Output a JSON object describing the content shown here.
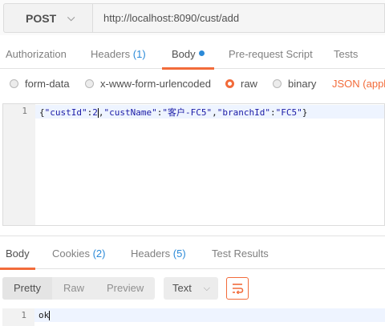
{
  "request": {
    "method": "POST",
    "url": "http://localhost:8090/cust/add"
  },
  "request_tabs": [
    {
      "label": "Authorization"
    },
    {
      "label": "Headers",
      "count": "(1)"
    },
    {
      "label": "Body"
    },
    {
      "label": "Pre-request Script"
    },
    {
      "label": "Tests"
    }
  ],
  "body_types": [
    {
      "label": "form-data",
      "selected": false
    },
    {
      "label": "x-www-form-urlencoded",
      "selected": false
    },
    {
      "label": "raw",
      "selected": true
    },
    {
      "label": "binary",
      "selected": false
    }
  ],
  "content_type": "JSON (applic",
  "editor": {
    "line_number": "1",
    "code_parts": [
      "{",
      "\"custId\"",
      ":",
      "2",
      ",",
      "\"custName\"",
      ":",
      "\"客户-FC5\"",
      ",",
      "\"branchId\"",
      ":",
      "\"FC5\"",
      "}"
    ]
  },
  "response_tabs": [
    {
      "label": "Body"
    },
    {
      "label": "Cookies",
      "count": "(2)"
    },
    {
      "label": "Headers",
      "count": "(5)"
    },
    {
      "label": "Test Results"
    }
  ],
  "response_view_modes": [
    "Pretty",
    "Raw",
    "Preview"
  ],
  "response_format": "Text",
  "response_body": {
    "line_number": "1",
    "text": "ok"
  },
  "colors": {
    "accent": "#f26b3a",
    "link": "#2b8ad8"
  },
  "icons": {
    "method_dropdown": "chevron-down-icon",
    "format_dropdown": "chevron-down-icon",
    "wrap": "wrap-lines-icon",
    "body_modified": "dot-indicator"
  }
}
